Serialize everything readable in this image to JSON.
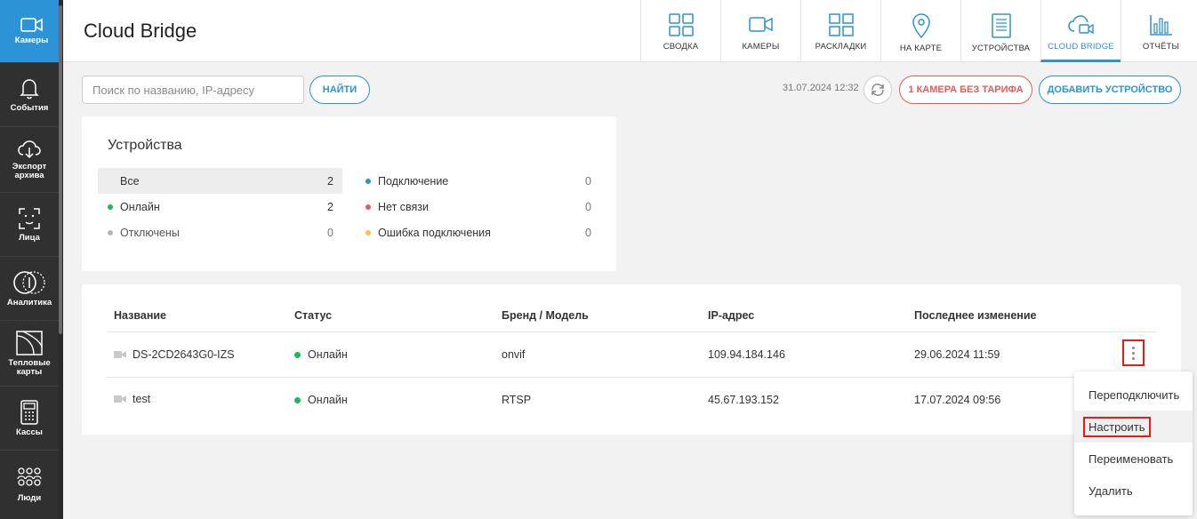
{
  "app": {
    "title": "Cloud Bridge",
    "accent_color": "#2b93d6",
    "danger_color": "#e45b5b"
  },
  "sidebar": {
    "items": [
      {
        "label": "Камеры",
        "icon": "camera-icon",
        "active": true
      },
      {
        "label": "События",
        "icon": "bell-icon"
      },
      {
        "label": "Экспорт архива",
        "icon": "cloud-download-icon"
      },
      {
        "label": "Лица",
        "icon": "face-scan-icon"
      },
      {
        "label": "Аналитика",
        "icon": "analytics-icon"
      },
      {
        "label": "Тепловые карты",
        "icon": "heatmap-icon"
      },
      {
        "label": "Кассы",
        "icon": "cash-register-icon"
      },
      {
        "label": "Люди",
        "icon": "people-icon"
      }
    ]
  },
  "nav": {
    "tabs": [
      {
        "label": "СВОДКА",
        "icon": "grid-icon"
      },
      {
        "label": "КАМЕРЫ",
        "icon": "camera-icon"
      },
      {
        "label": "РАСКЛАДКИ",
        "icon": "layout-icon"
      },
      {
        "label": "НА КАРТЕ",
        "icon": "map-pin-icon"
      },
      {
        "label": "УСТРОЙСТВА",
        "icon": "server-icon"
      },
      {
        "label": "CLOUD BRIDGE",
        "icon": "cloud-camera-icon",
        "active": true
      },
      {
        "label": "ОТЧЁТЫ",
        "icon": "bar-chart-icon"
      }
    ]
  },
  "toolbar": {
    "search_placeholder": "Поиск по названию, IP-адресу",
    "find_label": "НАЙТИ",
    "timestamp": "31.07.2024 12:32",
    "tariff_label": "1 КАМЕРА БЕЗ ТАРИФА",
    "add_device_label": "ДОБАВИТЬ УСТРОЙСТВО"
  },
  "devices_summary": {
    "title": "Устройства",
    "stats": [
      {
        "label": "Все",
        "value": "2",
        "dot": null,
        "selected": true
      },
      {
        "label": "Онлайн",
        "value": "2",
        "dot": "#1db954"
      },
      {
        "label": "Отключены",
        "value": "0",
        "dot": "#b5b5b5"
      },
      {
        "label": "Подключение",
        "value": "0",
        "dot": "#2b93d6"
      },
      {
        "label": "Нет связи",
        "value": "0",
        "dot": "#e45b5b"
      },
      {
        "label": "Ошибка подключения",
        "value": "0",
        "dot": "#f2c14e"
      }
    ]
  },
  "table": {
    "columns": [
      "Название",
      "Статус",
      "Бренд / Модель",
      "IP-адрес",
      "Последнее изменение"
    ],
    "rows": [
      {
        "name": "DS-2CD2643G0-IZS",
        "status": "Онлайн",
        "brand": "onvif",
        "ip": "109.94.184.146",
        "changed": "29.06.2024 11:59"
      },
      {
        "name": "test",
        "status": "Онлайн",
        "brand": "RTSP",
        "ip": "45.67.193.152",
        "changed": "17.07.2024 09:56"
      }
    ],
    "status_color": "#1db954"
  },
  "context_menu": {
    "items": [
      "Переподключить",
      "Настроить",
      "Переименовать",
      "Удалить"
    ]
  }
}
